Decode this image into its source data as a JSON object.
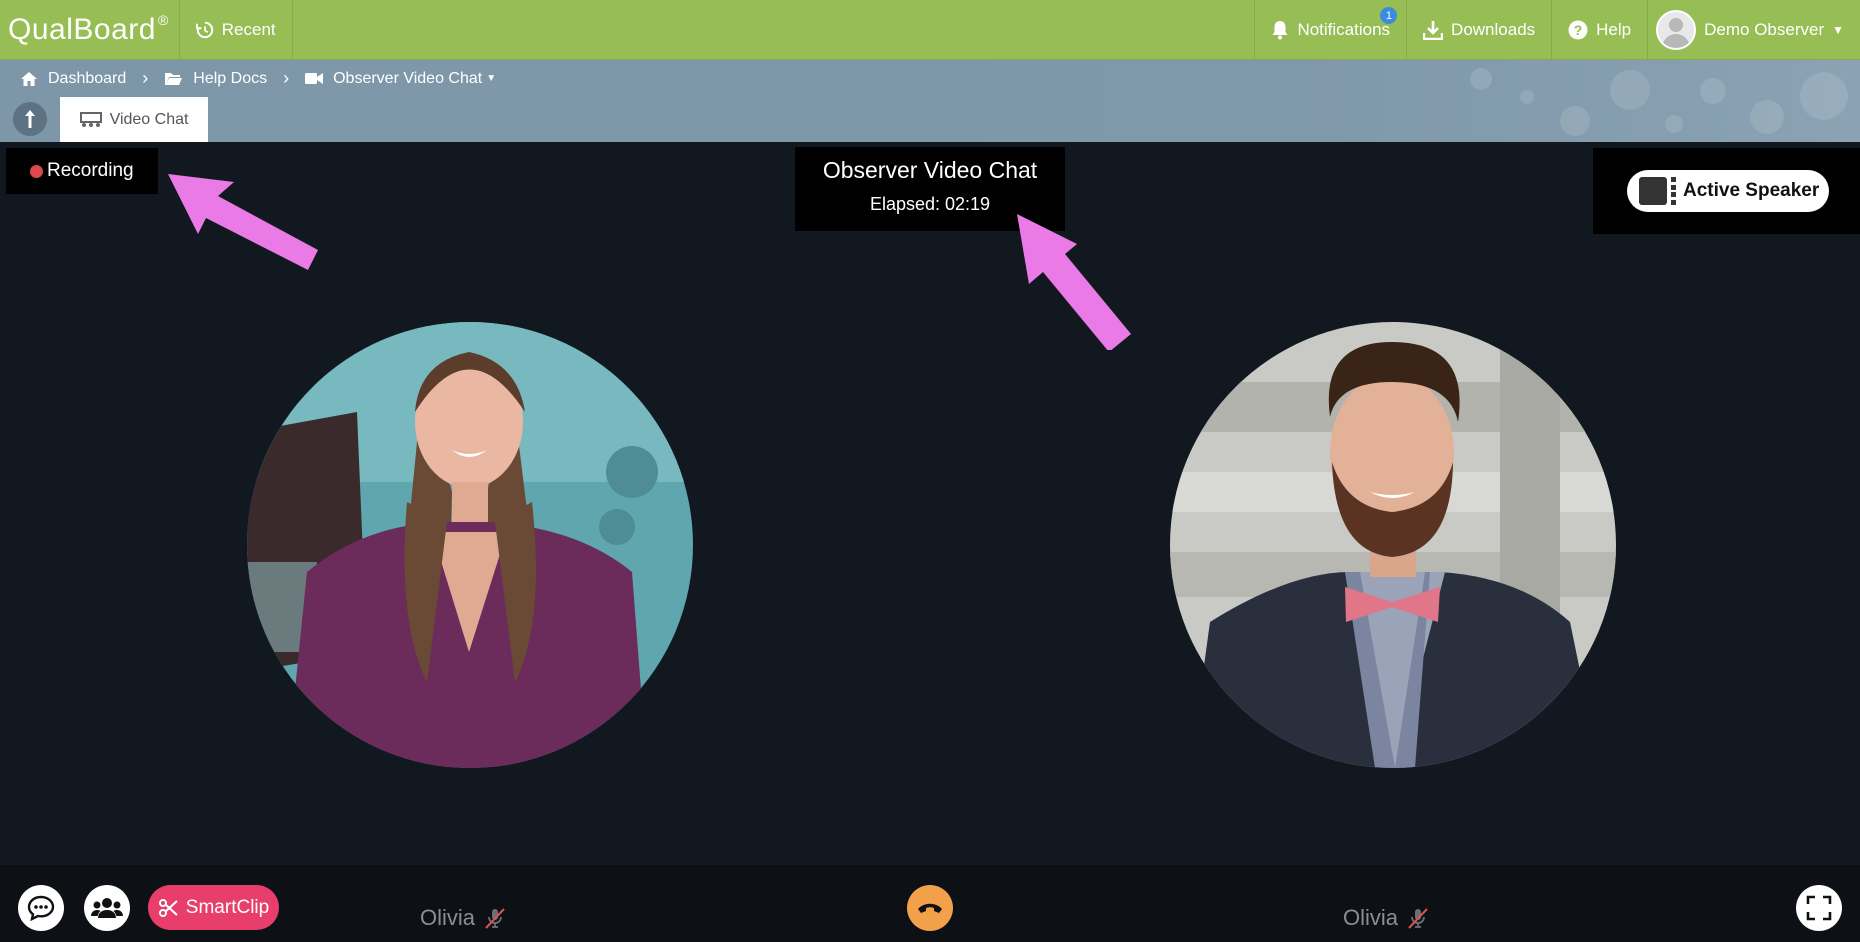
{
  "topbar": {
    "logo": "QualBoard",
    "logo_mark": "®",
    "recent_label": "Recent",
    "notifications_label": "Notifications",
    "notifications_count": "1",
    "downloads_label": "Downloads",
    "help_label": "Help",
    "user_name": "Demo Observer"
  },
  "breadcrumb": {
    "items": [
      "Dashboard",
      "Help Docs",
      "Observer Video Chat"
    ]
  },
  "tabs": [
    {
      "label": "Video Chat"
    }
  ],
  "stage": {
    "recording_label": "Recording",
    "title": "Observer Video Chat",
    "elapsed": "Elapsed: 02:19",
    "active_speaker_label": "Active Speaker"
  },
  "participants": [
    {
      "name": "Olivia"
    },
    {
      "name": "Olivia"
    }
  ],
  "bottom": {
    "smartclip_label": "SmartClip"
  },
  "colors": {
    "topbar": "#97bd55",
    "band": "#7d97a9",
    "stage": "#121820",
    "recording_dot": "#e0474c",
    "smartclip": "#e83e6b",
    "hangup": "#f2a14a",
    "annotation_arrow": "#e97ae6"
  }
}
